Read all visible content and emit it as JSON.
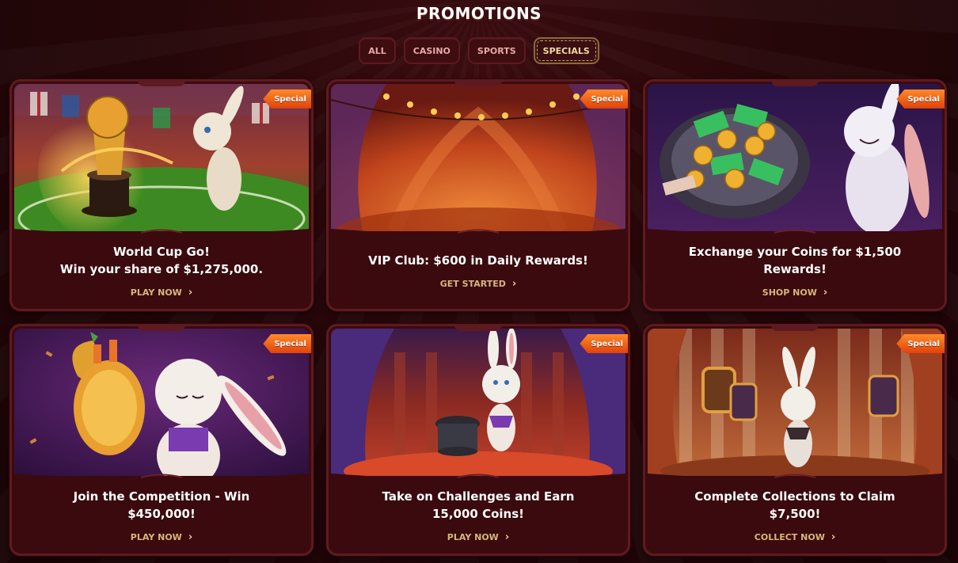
{
  "page": {
    "title": "Promotions"
  },
  "filters": [
    {
      "label": "ALL",
      "active": false
    },
    {
      "label": "CASINO",
      "active": false
    },
    {
      "label": "SPORTS",
      "active": false
    },
    {
      "label": "SPECIALS",
      "active": true
    }
  ],
  "cards": [
    {
      "badge": "Special",
      "title_line1": "World Cup Go!",
      "title_line2": "Win your share of $1,275,000.",
      "cta": "Play Now",
      "image": "world-cup-trophy-rabbit-image"
    },
    {
      "badge": "Special",
      "title_line1": "VIP Club: $600 in Daily Rewards!",
      "title_line2": "",
      "cta": "Get Started",
      "image": "circus-tent-image"
    },
    {
      "badge": "Special",
      "title_line1": "Exchange your Coins for $1,500",
      "title_line2": "Rewards!",
      "cta": "Shop Now",
      "image": "coins-plate-rabbit-image"
    },
    {
      "badge": "Special",
      "title_line1": "Join the Competition - Win",
      "title_line2": "$450,000!",
      "cta": "Play Now",
      "image": "golden-trophy-rabbit-image"
    },
    {
      "badge": "Special",
      "title_line1": "Take on Challenges and Earn",
      "title_line2": "15,000 Coins!",
      "cta": "Play Now",
      "image": "magician-rabbit-image"
    },
    {
      "badge": "Special",
      "title_line1": "Complete Collections to Claim",
      "title_line2": "$7,500!",
      "cta": "Collect Now",
      "image": "collection-gallery-rabbit-image"
    }
  ],
  "colors": {
    "card_bg": "#3b0a0f",
    "card_border": "#5e1a20",
    "cta": "#d6b77a",
    "badge": "#e0420a"
  }
}
